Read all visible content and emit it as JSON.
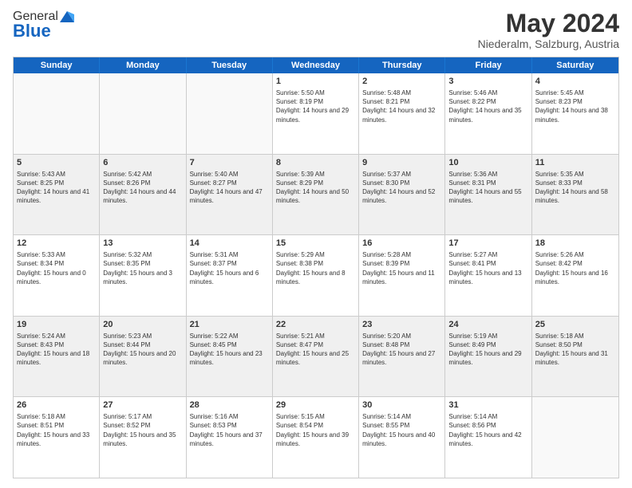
{
  "header": {
    "logo_general": "General",
    "logo_blue": "Blue",
    "month_title": "May 2024",
    "location": "Niederalm, Salzburg, Austria"
  },
  "days_of_week": [
    "Sunday",
    "Monday",
    "Tuesday",
    "Wednesday",
    "Thursday",
    "Friday",
    "Saturday"
  ],
  "rows": [
    [
      {
        "day": "",
        "empty": true
      },
      {
        "day": "",
        "empty": true
      },
      {
        "day": "",
        "empty": true
      },
      {
        "day": "1",
        "sunrise": "5:50 AM",
        "sunset": "8:19 PM",
        "daylight": "14 hours and 29 minutes."
      },
      {
        "day": "2",
        "sunrise": "5:48 AM",
        "sunset": "8:21 PM",
        "daylight": "14 hours and 32 minutes."
      },
      {
        "day": "3",
        "sunrise": "5:46 AM",
        "sunset": "8:22 PM",
        "daylight": "14 hours and 35 minutes."
      },
      {
        "day": "4",
        "sunrise": "5:45 AM",
        "sunset": "8:23 PM",
        "daylight": "14 hours and 38 minutes."
      }
    ],
    [
      {
        "day": "5",
        "sunrise": "5:43 AM",
        "sunset": "8:25 PM",
        "daylight": "14 hours and 41 minutes."
      },
      {
        "day": "6",
        "sunrise": "5:42 AM",
        "sunset": "8:26 PM",
        "daylight": "14 hours and 44 minutes."
      },
      {
        "day": "7",
        "sunrise": "5:40 AM",
        "sunset": "8:27 PM",
        "daylight": "14 hours and 47 minutes."
      },
      {
        "day": "8",
        "sunrise": "5:39 AM",
        "sunset": "8:29 PM",
        "daylight": "14 hours and 50 minutes."
      },
      {
        "day": "9",
        "sunrise": "5:37 AM",
        "sunset": "8:30 PM",
        "daylight": "14 hours and 52 minutes."
      },
      {
        "day": "10",
        "sunrise": "5:36 AM",
        "sunset": "8:31 PM",
        "daylight": "14 hours and 55 minutes."
      },
      {
        "day": "11",
        "sunrise": "5:35 AM",
        "sunset": "8:33 PM",
        "daylight": "14 hours and 58 minutes."
      }
    ],
    [
      {
        "day": "12",
        "sunrise": "5:33 AM",
        "sunset": "8:34 PM",
        "daylight": "15 hours and 0 minutes."
      },
      {
        "day": "13",
        "sunrise": "5:32 AM",
        "sunset": "8:35 PM",
        "daylight": "15 hours and 3 minutes."
      },
      {
        "day": "14",
        "sunrise": "5:31 AM",
        "sunset": "8:37 PM",
        "daylight": "15 hours and 6 minutes."
      },
      {
        "day": "15",
        "sunrise": "5:29 AM",
        "sunset": "8:38 PM",
        "daylight": "15 hours and 8 minutes."
      },
      {
        "day": "16",
        "sunrise": "5:28 AM",
        "sunset": "8:39 PM",
        "daylight": "15 hours and 11 minutes."
      },
      {
        "day": "17",
        "sunrise": "5:27 AM",
        "sunset": "8:41 PM",
        "daylight": "15 hours and 13 minutes."
      },
      {
        "day": "18",
        "sunrise": "5:26 AM",
        "sunset": "8:42 PM",
        "daylight": "15 hours and 16 minutes."
      }
    ],
    [
      {
        "day": "19",
        "sunrise": "5:24 AM",
        "sunset": "8:43 PM",
        "daylight": "15 hours and 18 minutes."
      },
      {
        "day": "20",
        "sunrise": "5:23 AM",
        "sunset": "8:44 PM",
        "daylight": "15 hours and 20 minutes."
      },
      {
        "day": "21",
        "sunrise": "5:22 AM",
        "sunset": "8:45 PM",
        "daylight": "15 hours and 23 minutes."
      },
      {
        "day": "22",
        "sunrise": "5:21 AM",
        "sunset": "8:47 PM",
        "daylight": "15 hours and 25 minutes."
      },
      {
        "day": "23",
        "sunrise": "5:20 AM",
        "sunset": "8:48 PM",
        "daylight": "15 hours and 27 minutes."
      },
      {
        "day": "24",
        "sunrise": "5:19 AM",
        "sunset": "8:49 PM",
        "daylight": "15 hours and 29 minutes."
      },
      {
        "day": "25",
        "sunrise": "5:18 AM",
        "sunset": "8:50 PM",
        "daylight": "15 hours and 31 minutes."
      }
    ],
    [
      {
        "day": "26",
        "sunrise": "5:18 AM",
        "sunset": "8:51 PM",
        "daylight": "15 hours and 33 minutes."
      },
      {
        "day": "27",
        "sunrise": "5:17 AM",
        "sunset": "8:52 PM",
        "daylight": "15 hours and 35 minutes."
      },
      {
        "day": "28",
        "sunrise": "5:16 AM",
        "sunset": "8:53 PM",
        "daylight": "15 hours and 37 minutes."
      },
      {
        "day": "29",
        "sunrise": "5:15 AM",
        "sunset": "8:54 PM",
        "daylight": "15 hours and 39 minutes."
      },
      {
        "day": "30",
        "sunrise": "5:14 AM",
        "sunset": "8:55 PM",
        "daylight": "15 hours and 40 minutes."
      },
      {
        "day": "31",
        "sunrise": "5:14 AM",
        "sunset": "8:56 PM",
        "daylight": "15 hours and 42 minutes."
      },
      {
        "day": "",
        "empty": true
      }
    ]
  ]
}
